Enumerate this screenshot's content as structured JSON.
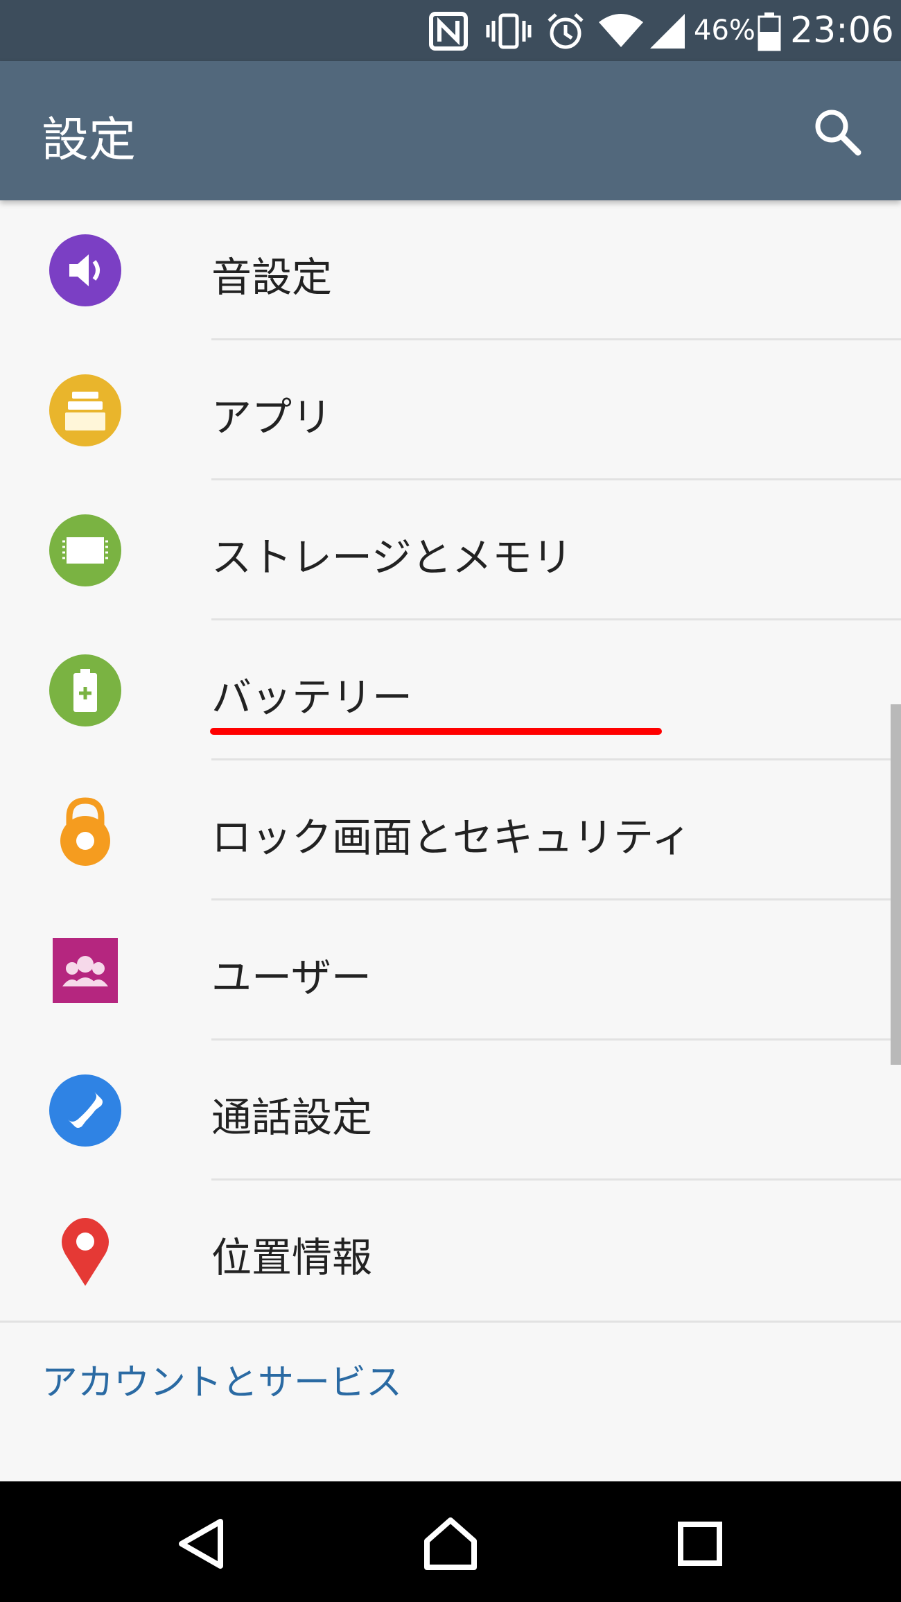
{
  "status_bar": {
    "icons": [
      "nfc-icon",
      "vibrate-icon",
      "alarm-icon",
      "wifi-icon",
      "signal-icon",
      "battery-icon"
    ],
    "battery_percent": "46%",
    "time": "23:06"
  },
  "app_bar": {
    "title": "設定",
    "search_icon": "search-icon"
  },
  "settings_items": [
    {
      "label": "音設定",
      "icon": "sound-icon",
      "icon_color": "#7b3fc4"
    },
    {
      "label": "アプリ",
      "icon": "apps-icon",
      "icon_color": "#e9b52c"
    },
    {
      "label": "ストレージとメモリ",
      "icon": "storage-icon",
      "icon_color": "#7ab342"
    },
    {
      "label": "バッテリー",
      "icon": "battery-settings-icon",
      "icon_color": "#7ab342"
    },
    {
      "label": "ロック画面とセキュリティ",
      "icon": "lock-icon",
      "icon_color": "#f59c1f"
    },
    {
      "label": "ユーザー",
      "icon": "users-icon",
      "icon_color": "#b5267f"
    },
    {
      "label": "通話設定",
      "icon": "phone-icon",
      "icon_color": "#2f83e4"
    },
    {
      "label": "位置情報",
      "icon": "location-icon",
      "icon_color": "#e53935"
    }
  ],
  "highlight": {
    "target": "バッテリー",
    "color": "#ff0000"
  },
  "section": {
    "header": "アカウントとサービス"
  },
  "nav_bar": {
    "icons": [
      "back-icon",
      "home-icon",
      "recents-icon"
    ]
  },
  "colors": {
    "status_bar": "#3d4d5c",
    "app_bar": "#52687c",
    "background": "#f7f7f7",
    "section_header": "#2a6aa3"
  }
}
